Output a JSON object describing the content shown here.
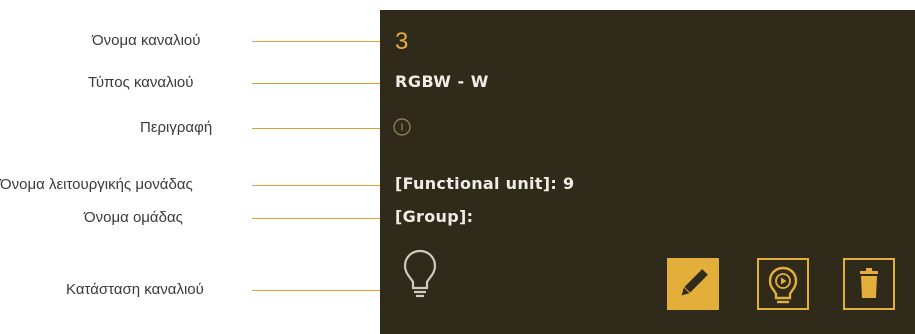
{
  "callouts": {
    "channel_name": "Όνομα καναλιού",
    "channel_type": "Τύπος καναλιού",
    "description": "Περιγραφή",
    "functional_unit_name": "Όνομα λειτουργικής μονάδας",
    "group_name": "Όνομα ομάδας",
    "channel_state": "Κατάσταση καναλιού"
  },
  "panel": {
    "channel_name": "3",
    "channel_type": "RGBW - W",
    "functional_unit": "[Functional unit]: 9",
    "group": "[Group]:",
    "state_icon": "lightbulb-off-icon",
    "actions": [
      "pencil-icon",
      "lightbulb-play-icon",
      "trash-icon"
    ]
  },
  "colors": {
    "accent": "#e3ae3a",
    "panel_background": "#2f2a1a",
    "panel_text": "#f0ede6",
    "callout_line": "#e0a030"
  }
}
